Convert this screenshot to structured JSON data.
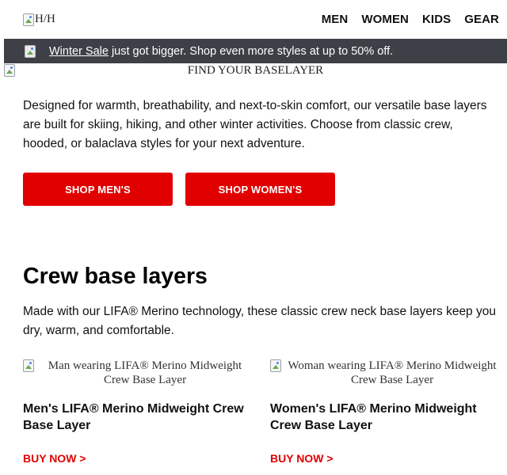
{
  "header": {
    "logo_alt": "H/H",
    "nav": [
      "MEN",
      "WOMEN",
      "KIDS",
      "GEAR"
    ]
  },
  "promo": {
    "link_text": "Winter Sale",
    "text": "just got bigger. Shop even more styles at up to 50% off."
  },
  "hero": {
    "image_alt": "FIND YOUR BASELAYER"
  },
  "intro": {
    "text": "Designed for warmth, breathability, and next-to-skin comfort, our versatile base layers are built for skiing, hiking, and other winter activities. Choose from classic crew, hooded, or balaclava styles for your next adventure."
  },
  "buttons": {
    "men": "SHOP MEN'S",
    "women": "SHOP WOMEN'S"
  },
  "section": {
    "title": "Crew base layers",
    "description": "Made with our LIFA® Merino technology, these classic crew neck base layers keep you dry, warm, and comfortable."
  },
  "products": [
    {
      "image_alt": "Man wearing LIFA® Merino Midweight Crew Base Layer",
      "name": "Men's LIFA® Merino Midweight Crew Base Layer",
      "cta": "BUY NOW >"
    },
    {
      "image_alt": "Woman wearing LIFA® Merino Midweight Crew Base Layer",
      "name": "Women's LIFA® Merino Midweight Crew Base Layer",
      "cta": "BUY NOW >"
    }
  ],
  "colors": {
    "accent": "#e10000",
    "promo_bg": "#3d4047"
  }
}
